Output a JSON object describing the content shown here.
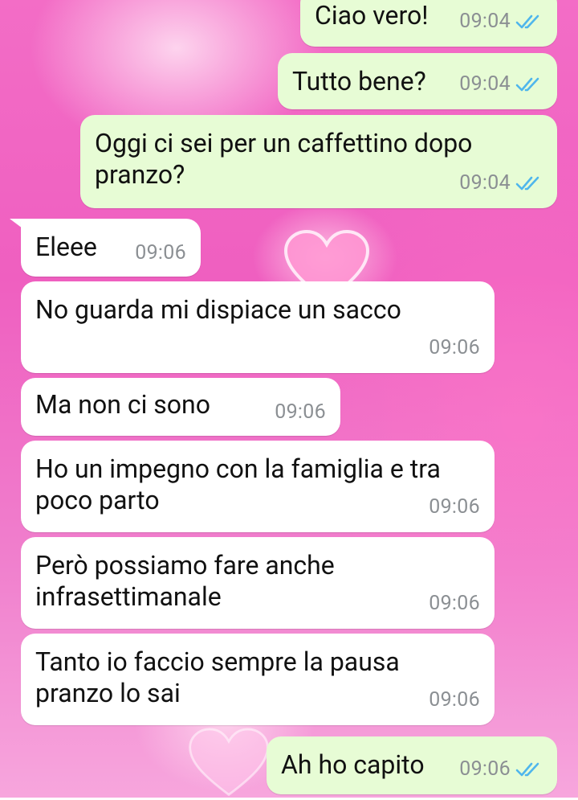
{
  "colors": {
    "outgoing_bubble": "#e7fcd5",
    "incoming_bubble": "#ffffff",
    "tick_blue": "#4fb6ec",
    "timestamp_gray": "#8b8f93"
  },
  "messages": [
    {
      "direction": "out",
      "text": "Ciao vero!",
      "time": "09:04",
      "status_icon": "double-check-read-icon"
    },
    {
      "direction": "out",
      "text": "Tutto bene?",
      "time": "09:04",
      "status_icon": "double-check-read-icon"
    },
    {
      "direction": "out",
      "text": "Oggi ci sei per un caffettino dopo pranzo?",
      "time": "09:04",
      "status_icon": "double-check-read-icon"
    },
    {
      "direction": "in",
      "text": "Eleee",
      "time": "09:06"
    },
    {
      "direction": "in",
      "text": "No guarda mi dispiace un sacco",
      "time": "09:06"
    },
    {
      "direction": "in",
      "text": "Ma non ci sono",
      "time": "09:06"
    },
    {
      "direction": "in",
      "text": "Ho un impegno con la famiglia e tra poco parto",
      "time": "09:06"
    },
    {
      "direction": "in",
      "text": "Però possiamo fare anche infrasettimanale",
      "time": "09:06"
    },
    {
      "direction": "in",
      "text": "Tanto io faccio sempre la pausa pranzo lo sai",
      "time": "09:06"
    },
    {
      "direction": "out",
      "text": "Ah ho capito",
      "time": "09:06",
      "status_icon": "double-check-read-icon"
    }
  ]
}
